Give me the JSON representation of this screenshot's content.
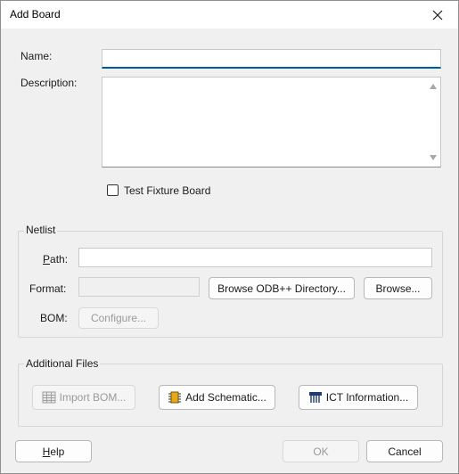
{
  "window": {
    "title": "Add Board"
  },
  "form": {
    "name_label": "Name:",
    "name_value": "",
    "description_label": "Description:",
    "description_value": "",
    "test_fixture_label": "Test Fixture Board",
    "test_fixture_checked": false
  },
  "netlist": {
    "group_title": "Netlist",
    "path_label_access": "P",
    "path_label_rest": "ath:",
    "path_value": "",
    "format_label": "Format:",
    "format_value": "",
    "browse_odb_label": "Browse ODB++ Directory...",
    "browse_label": "Browse...",
    "bom_label": "BOM:",
    "configure_label": "Configure..."
  },
  "additional_files": {
    "group_title": "Additional Files",
    "import_bom_label": "Import BOM...",
    "add_schematic_label": "Add Schematic...",
    "ict_information_label": "ICT Information..."
  },
  "footer": {
    "help_label_access": "H",
    "help_label_rest": "elp",
    "ok_label": "OK",
    "cancel_label": "Cancel"
  },
  "icons": {
    "close": "close-icon",
    "import_bom": "table-icon",
    "add_schematic": "chip-icon",
    "ict_information": "bed-of-nails-icon"
  }
}
